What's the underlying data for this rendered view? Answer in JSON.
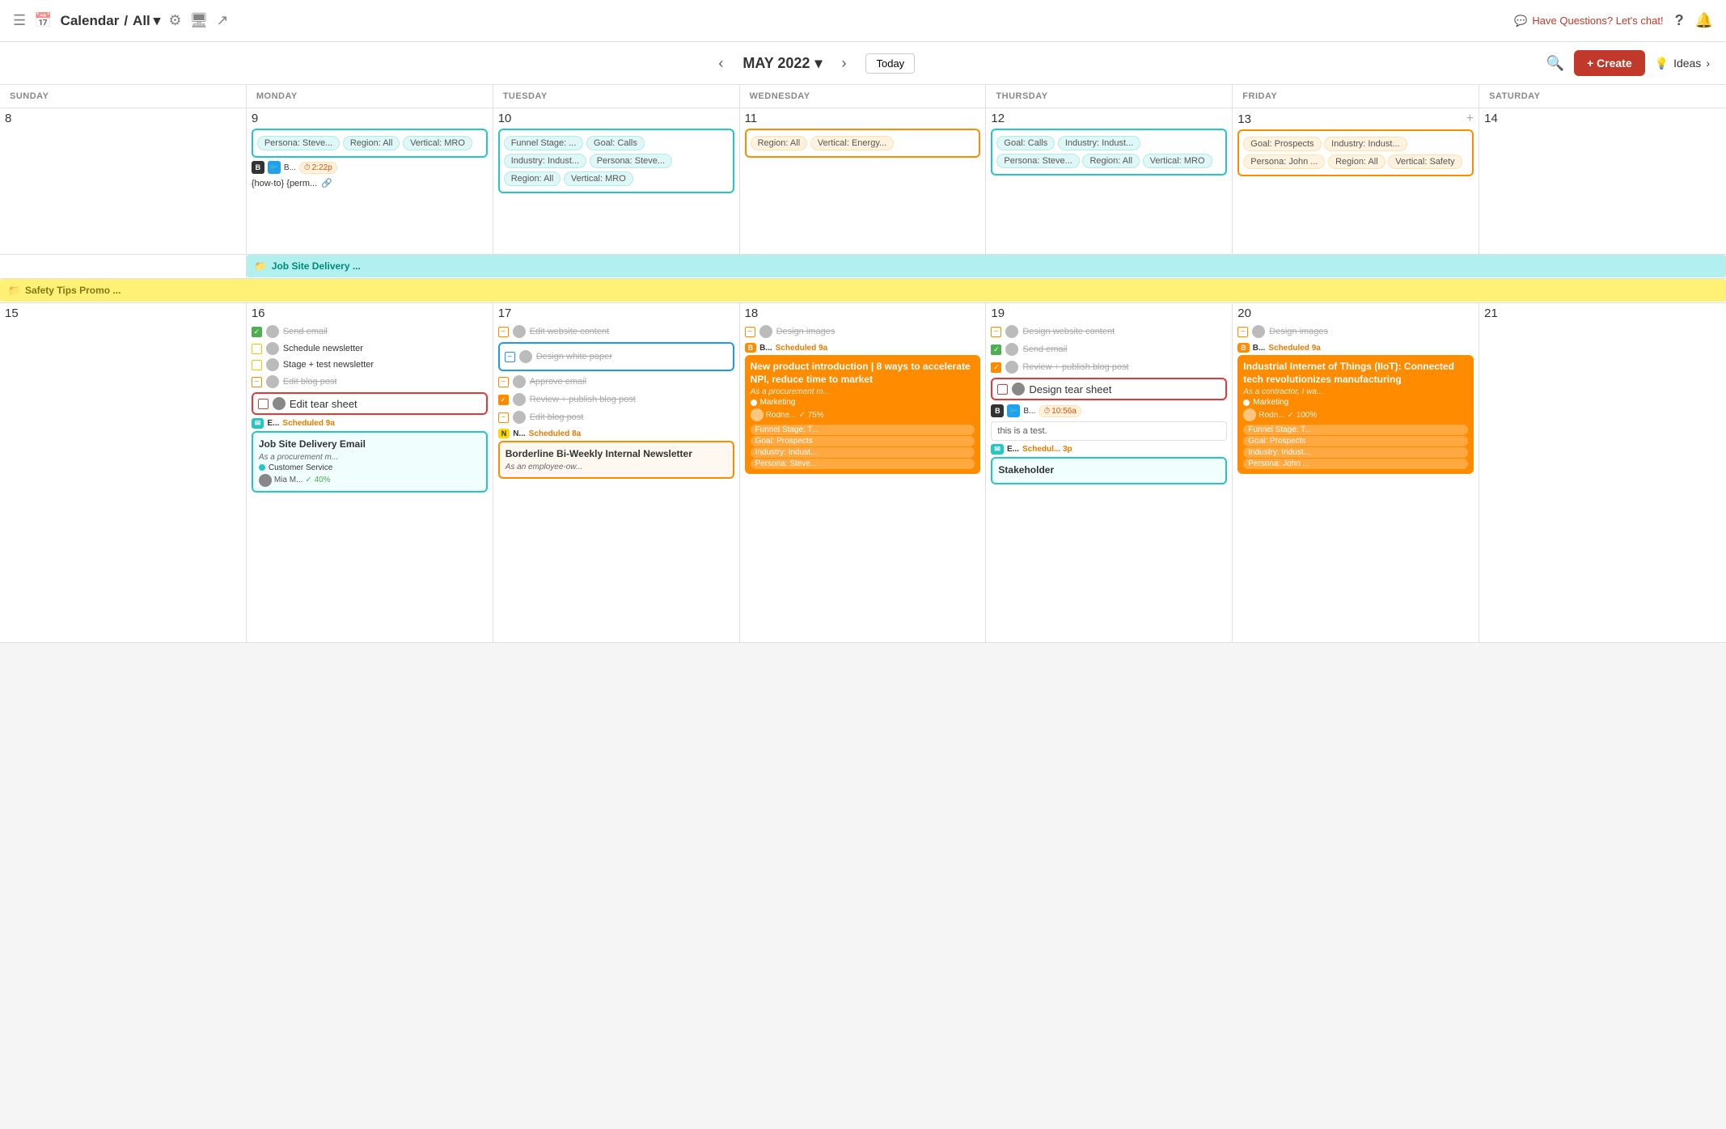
{
  "topNav": {
    "menuIcon": "☰",
    "calIcon": "📅",
    "title": "Calendar",
    "sep": "/",
    "view": "All",
    "filterIcon": "filter",
    "monitorIcon": "monitor",
    "shareIcon": "share",
    "chatText": "Have Questions? Let's chat!",
    "helpIcon": "?",
    "bellIcon": "🔔"
  },
  "calToolbar": {
    "prevIcon": "‹",
    "nextIcon": "›",
    "month": "MAY 2022",
    "chevron": "▾",
    "today": "Today",
    "searchIcon": "🔍",
    "createLabel": "+ Create",
    "ideasLabel": "Ideas"
  },
  "dayHeaders": [
    "SUNDAY",
    "MONDAY",
    "TUESDAY",
    "WEDNESDAY",
    "THURSDAY",
    "FRIDAY",
    "SATURDAY"
  ],
  "week1": {
    "days": [
      8,
      9,
      10,
      11,
      12,
      13,
      14
    ],
    "mon9": {
      "tags": [
        "Persona: Steve...",
        "Region: All",
        "Vertical: MRO"
      ],
      "socialTime": "2:22p",
      "socialLabel": "B...",
      "blogItem": "{how-to} {perm..."
    },
    "tue10": {
      "tags": [
        "Funnel Stage: ...",
        "Goal: Calls",
        "Industry: Indust...",
        "Persona: Steve...",
        "Region: All",
        "Vertical: MRO"
      ]
    },
    "wed11": {
      "tags": [
        "Region: All",
        "Vertical: Energy..."
      ]
    },
    "thu12": {
      "tags": [
        "Goal: Calls",
        "Industry: Indust...",
        "Persona: Steve...",
        "Region: All",
        "Vertical: MRO"
      ]
    },
    "fri13": {
      "tags": [
        "Goal: Prospects",
        "Industry: Indust...",
        "Persona: John ...",
        "Region: All",
        "Vertical: Safety"
      ],
      "plusBtn": "+"
    }
  },
  "spanBar1": {
    "label": "Job Site Delivery ...",
    "icon": "📁"
  },
  "spanBar2": {
    "label": "Safety Tips Promo ...",
    "icon": "📁"
  },
  "week2": {
    "days": [
      15,
      16,
      17,
      18,
      19,
      20,
      21
    ],
    "sun15": {},
    "mon16": {
      "tasks": [
        {
          "type": "checked",
          "label": "Send email",
          "strikethrough": true
        },
        {
          "type": "yellow",
          "label": "Schedule newsletter"
        },
        {
          "type": "yellow",
          "label": "Stage + test newsletter"
        },
        {
          "type": "minus",
          "label": "Edit blog post",
          "strikethrough": true
        },
        {
          "type": "red-border",
          "label": "Edit tear sheet",
          "hasAvatar": true
        }
      ],
      "scheduledCard": {
        "channel": "E...",
        "time": "Scheduled 9a",
        "title": "Job Site Delivery Email",
        "meta": "As a procurement m...",
        "dotColor": "teal",
        "dotLabel": "Customer Service",
        "avatar": true,
        "progress": "Mia M...",
        "progressPct": "40%"
      }
    },
    "tue17": {
      "tasks": [
        {
          "type": "minus",
          "label": "Edit website content",
          "strikethrough": true
        },
        {
          "type": "blue-outline-card",
          "label": "Design white paper",
          "strikethrough": true
        },
        {
          "type": "minus",
          "label": "Approve email",
          "strikethrough": true
        },
        {
          "type": "checked-orange",
          "label": "Review + publish blog post",
          "strikethrough": true
        },
        {
          "type": "minus",
          "label": "Edit blog post",
          "strikethrough": true
        }
      ],
      "scheduledCard": {
        "channel": "N...",
        "time": "Scheduled 8a",
        "title": "Borderline Bi-Weekly Internal Newsletter",
        "meta": "As an employee-ow..."
      }
    },
    "wed18": {
      "tasks": [
        {
          "type": "minus",
          "label": "Design images",
          "strikethrough": true
        }
      ],
      "scheduledCard": {
        "channel": "B...",
        "time": "Scheduled 9a",
        "title": "New product introduction | 8 ways to accelerate NPI, reduce time to market",
        "meta": "As a procurement m...",
        "dotColor": "orange",
        "dotLabel": "Marketing",
        "avatar": true,
        "progress": "Rodne...",
        "progressPct": "75%",
        "tags": [
          "Funnel Stage: T...",
          "Goal: Prospects",
          "Industry: Indust...",
          "Persona: Steve..."
        ]
      }
    },
    "thu19": {
      "tasks": [
        {
          "type": "minus",
          "label": "Design website content",
          "strikethrough": true
        },
        {
          "type": "checked",
          "label": "Send email",
          "strikethrough": true
        },
        {
          "type": "checked-orange",
          "label": "Review + publish blog post",
          "strikethrough": true
        },
        {
          "type": "red-border",
          "label": "Design tear sheet",
          "hasAvatar": true
        }
      ],
      "socialRow": {
        "label": "B...",
        "time": "10:56a"
      },
      "noteBox": "this is a test.",
      "scheduledCard": {
        "channel": "E...",
        "time": "Schedul... 3p",
        "title": "Stakeholder"
      }
    },
    "fri20": {
      "tasks": [
        {
          "type": "minus",
          "label": "Design images",
          "strikethrough": true
        }
      ],
      "scheduledCard": {
        "channel": "B...",
        "time": "Scheduled 9a",
        "title": "Industrial Internet of Things (IIoT): Connected tech revolutionizes manufacturing",
        "meta": "As a contractor, I wa...",
        "dotColor": "orange",
        "dotLabel": "Marketing",
        "avatar": true,
        "progress": "Rodn...",
        "progressPct": "100%",
        "tags": [
          "Funnel Stage: T...",
          "Goal: Prospects",
          "Industry: Indust...",
          "Persona: John ..."
        ]
      }
    },
    "sat21": {}
  }
}
